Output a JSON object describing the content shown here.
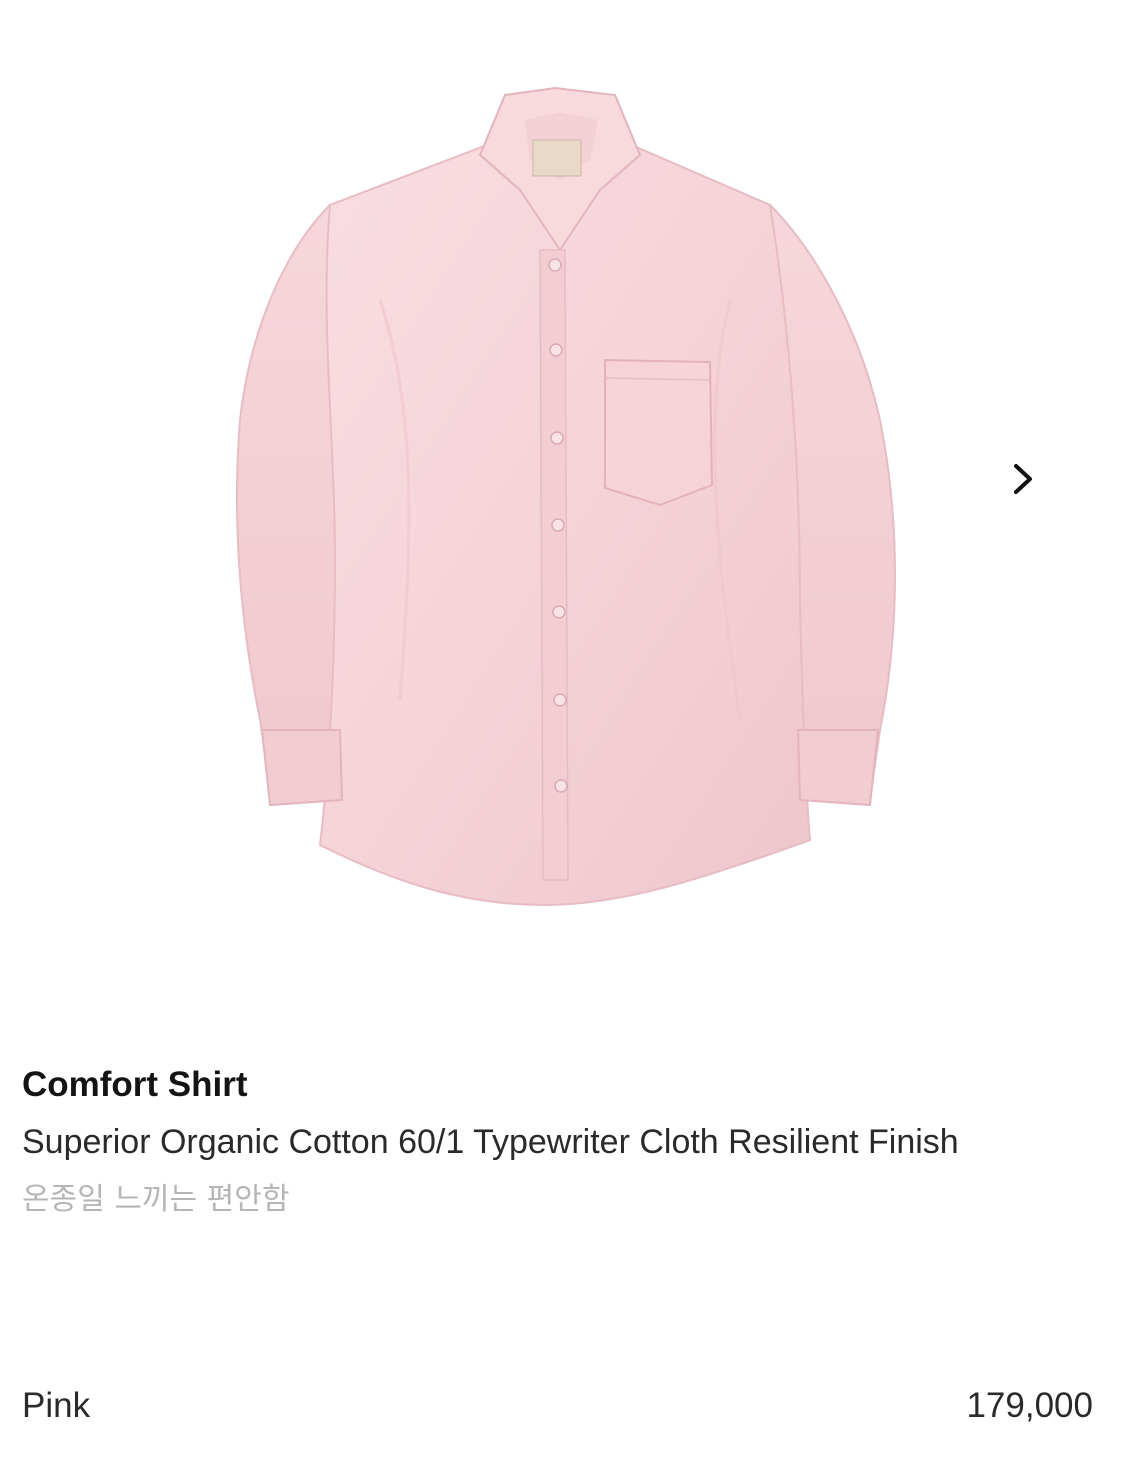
{
  "gallery": {
    "image_alt": "pink long-sleeve button-up shirt with chest pocket",
    "next_icon": "chevron-right-icon",
    "shirt_color": "#f6d6dc"
  },
  "product": {
    "title": "Comfort Shirt",
    "subtitle": "Superior Organic Cotton 60/1 Typewriter Cloth Resilient Finish",
    "tagline": "온종일 느끼는 편안함",
    "color": "Pink",
    "price": "179,000"
  }
}
